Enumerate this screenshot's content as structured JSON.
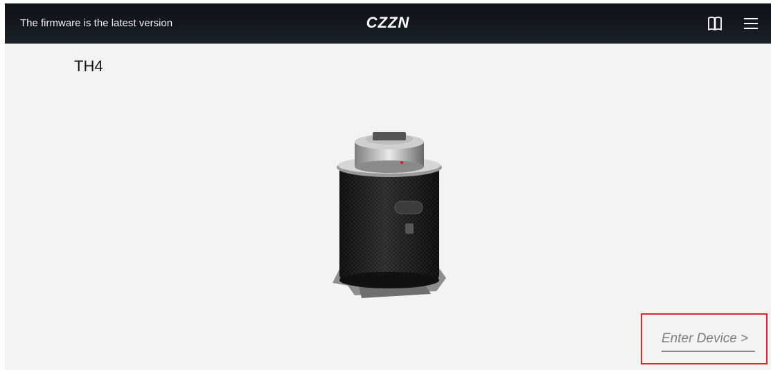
{
  "header": {
    "status_text": "The firmware is the latest version",
    "brand": "CZZN",
    "manual_icon": "book-icon",
    "menu_icon": "hamburger-menu-icon",
    "background": "#12161d"
  },
  "device": {
    "name": "TH4",
    "image": "device-photo"
  },
  "actions": {
    "enter_device_label": "Enter Device >",
    "highlight_color": "#e0252c"
  }
}
